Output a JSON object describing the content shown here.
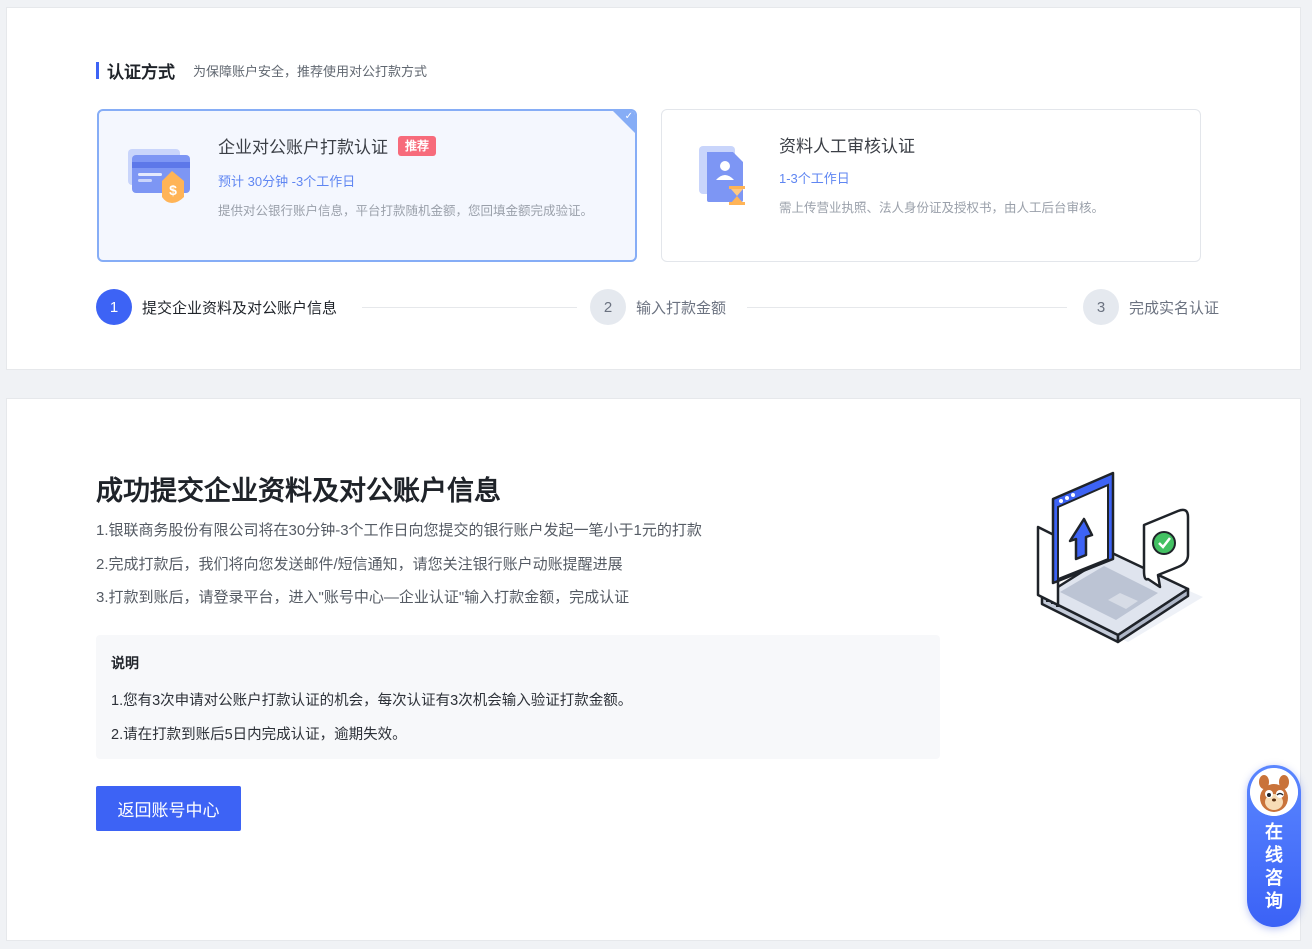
{
  "auth_section": {
    "title": "认证方式",
    "subtitle": "为保障账户安全，推荐使用对公打款方式"
  },
  "methods": [
    {
      "title": "企业对公账户打款认证",
      "badge": "推荐",
      "time": "预计 30分钟 -3个工作日",
      "desc": "提供对公银行账户信息，平台打款随机金额，您回填金额完成验证。",
      "icon": "bank-card-dollar-icon",
      "selected": true
    },
    {
      "title": "资料人工审核认证",
      "time": "1-3个工作日",
      "desc": "需上传营业执照、法人身份证及授权书，由人工后台审核。",
      "icon": "document-hourglass-icon",
      "selected": false
    }
  ],
  "steps": [
    {
      "num": "1",
      "label": "提交企业资料及对公账户信息",
      "active": true
    },
    {
      "num": "2",
      "label": "输入打款金额",
      "active": false
    },
    {
      "num": "3",
      "label": "完成实名认证",
      "active": false
    }
  ],
  "result": {
    "title": "成功提交企业资料及对公账户信息",
    "lines": [
      "1.银联商务股份有限公司将在30分钟-3个工作日向您提交的银行账户发起一笔小于1元的打款",
      "2.完成打款后，我们将向您发送邮件/短信通知，请您关注银行账户动账提醒进展",
      "3.打款到账后，请登录平台，进入\"账号中心—企业认证\"输入打款金额，完成认证"
    ],
    "note_title": "说明",
    "notes": [
      "1.您有3次申请对公账户打款认证的机会，每次认证有3次机会输入验证打款金额。",
      "2.请在打款到账后5日内完成认证，逾期失效。"
    ],
    "back_button": "返回账号中心",
    "illustration": "laptop-upload-illustration"
  },
  "consult": {
    "chars": [
      "在",
      "线",
      "咨",
      "询"
    ],
    "avatar": "squirrel-avatar-icon"
  },
  "colors": {
    "primary": "#3d63f5",
    "badge": "#f76b7b",
    "selected_border": "#86adf6"
  }
}
